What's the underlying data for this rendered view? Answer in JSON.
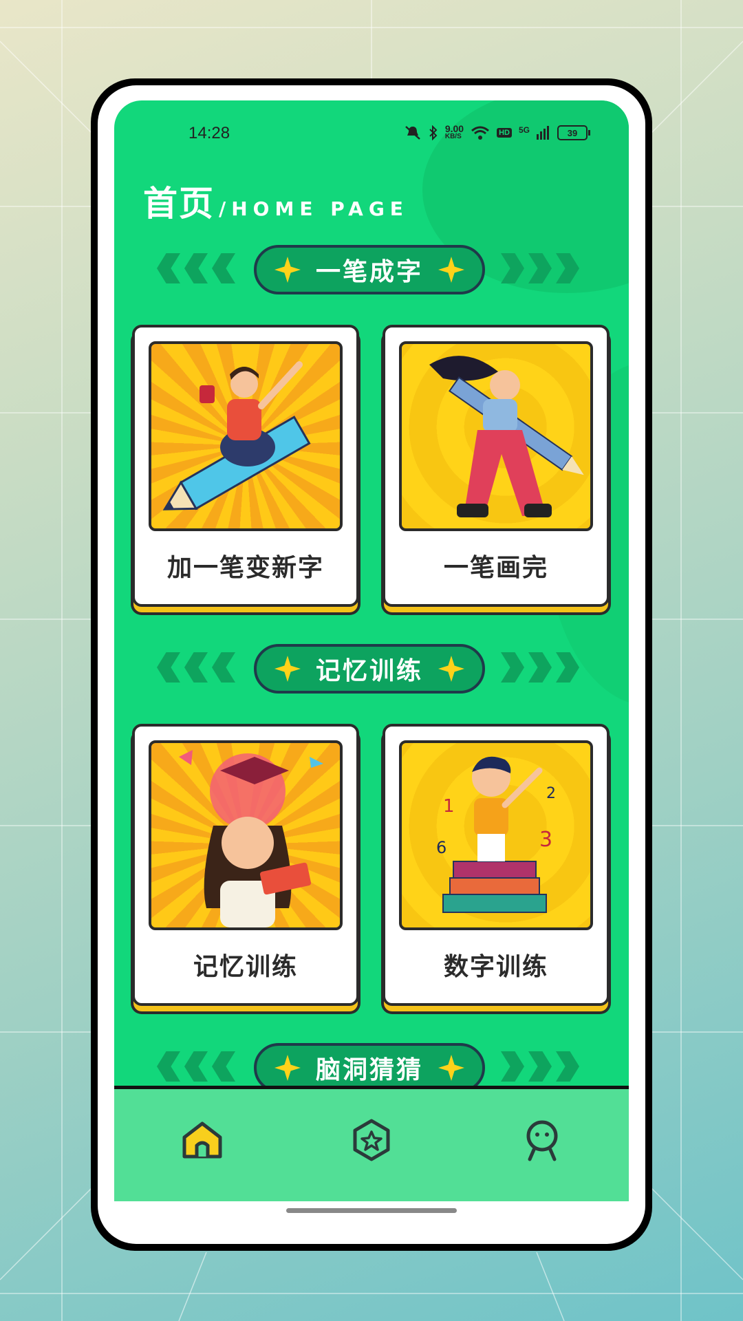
{
  "status_bar": {
    "time": "14:28",
    "network_speed": "9.00",
    "network_unit": "KB/S",
    "hd": "HD",
    "signal": "5G",
    "battery": "39"
  },
  "header": {
    "title_cn": "首页",
    "title_en": "/HOME PAGE"
  },
  "sections": [
    {
      "title": "一笔成字",
      "cards": [
        {
          "label": "加一笔变新字",
          "image": "boy-riding-pencil"
        },
        {
          "label": "一笔画完",
          "image": "girl-with-pencil"
        }
      ]
    },
    {
      "title": "记忆训练",
      "cards": [
        {
          "label": "记忆训练",
          "image": "girl-thinking"
        },
        {
          "label": "数字训练",
          "image": "boy-on-books"
        }
      ]
    },
    {
      "title": "脑洞猜猜",
      "cards": []
    }
  ],
  "bottom_nav": [
    {
      "icon": "home-icon",
      "active": true
    },
    {
      "icon": "star-badge-icon",
      "active": false
    },
    {
      "icon": "profile-icon",
      "active": false
    }
  ],
  "colors": {
    "screen_bg": "#12d77b",
    "pill_bg": "#0da35f",
    "accent_yellow": "#ffd21a",
    "nav_bg": "#52df96"
  }
}
